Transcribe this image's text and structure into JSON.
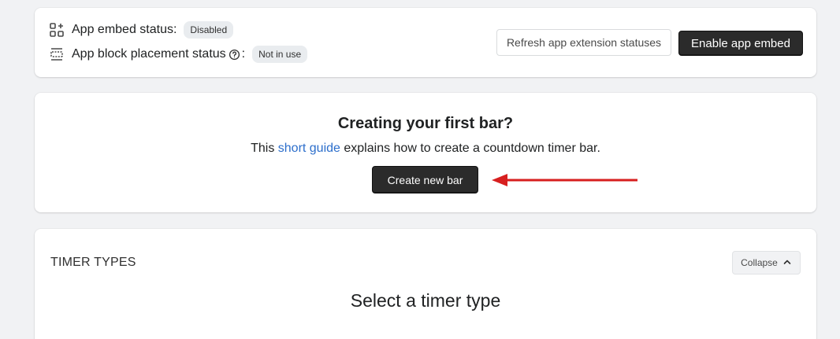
{
  "status": {
    "embed_label": "App embed status:",
    "embed_badge": "Disabled",
    "block_label": "App block placement status",
    "block_suffix": ":",
    "block_badge": "Not in use",
    "refresh_button": "Refresh app extension statuses",
    "enable_button": "Enable app embed",
    "icons": {
      "embed": "apps-plus-icon",
      "block": "layout-block-icon",
      "help": "question-circle-icon"
    }
  },
  "guide": {
    "title": "Creating your first bar?",
    "text_before": "This ",
    "link_text": "short guide",
    "text_after": " explains how to create a countdown timer bar.",
    "create_button": "Create new bar",
    "arrow_color": "#d71f1f"
  },
  "timer_types": {
    "section_label": "TIMER TYPES",
    "collapse_button": "Collapse",
    "heading": "Select a timer type",
    "collapse_icon": "chevron-up-icon"
  },
  "colors": {
    "link": "#2c6ecb",
    "primary_button": "#2b2b2b",
    "background": "#f1f2f4"
  }
}
